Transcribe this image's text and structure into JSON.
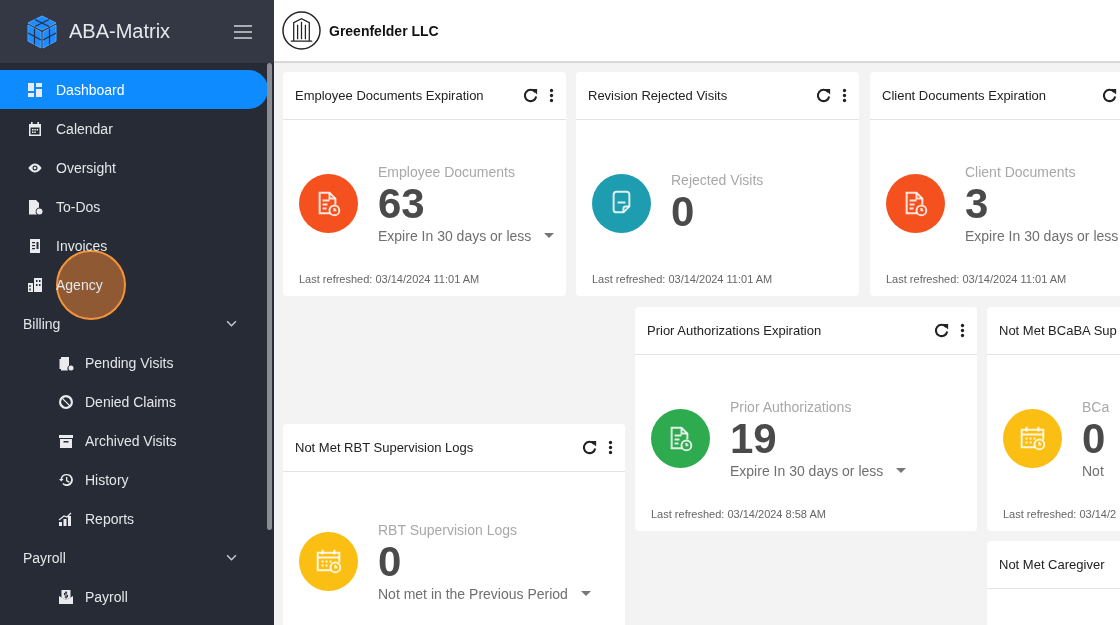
{
  "app": {
    "name": "ABA-Matrix"
  },
  "sidebar": {
    "items": [
      {
        "kind": "link",
        "label": "Dashboard",
        "selected": true
      },
      {
        "kind": "link",
        "label": "Calendar",
        "selected": false
      },
      {
        "kind": "link",
        "label": "Oversight",
        "selected": false
      },
      {
        "kind": "link",
        "label": "To-Dos",
        "selected": false
      },
      {
        "kind": "link",
        "label": "Invoices",
        "selected": false
      },
      {
        "kind": "link",
        "label": "Agency",
        "selected": false
      },
      {
        "kind": "section",
        "label": "Billing",
        "expanded": true,
        "children": [
          {
            "label": "Pending Visits",
            "selected": false
          },
          {
            "label": "Denied Claims",
            "selected": false
          },
          {
            "label": "Archived Visits",
            "selected": false
          },
          {
            "label": "History",
            "selected": false
          },
          {
            "label": "Reports",
            "selected": false
          }
        ]
      },
      {
        "kind": "section",
        "label": "Payroll",
        "expanded": true,
        "children": [
          {
            "label": "Payroll",
            "selected": false
          }
        ]
      }
    ]
  },
  "topbar": {
    "company": "Greenfelder LLC"
  },
  "widgets": [
    {
      "title": "Employee Documents Expiration",
      "refresh": true,
      "menu": true,
      "color": "#f4511e",
      "label": "Employee Documents",
      "value": "63",
      "caption": "Expire In 30 days or less",
      "dropdown": true,
      "refreshed": "Last refreshed: 03/14/2024 11:01 AM"
    },
    {
      "title": "Revision Rejected Visits",
      "refresh": true,
      "menu": true,
      "color": "#1e9db0",
      "label": "Rejected Visits",
      "value": "0",
      "refreshed": "Last refreshed: 03/14/2024 11:01 AM"
    },
    {
      "title": "Client Documents Expiration",
      "refresh": true,
      "color": "#f4511e",
      "label": "Client Documents",
      "value": "3",
      "caption": "Expire In 30 days or less",
      "dropdown": false,
      "refreshed": "Last refreshed: 03/14/2024 11:01 AM"
    },
    {
      "title": "Prior Authorizations Expiration",
      "refresh": true,
      "menu": true,
      "color": "#2eaa4f",
      "label": "Prior Authorizations",
      "value": "19",
      "caption": "Expire In 30 days or less",
      "dropdown": true,
      "refreshed": "Last refreshed: 03/14/2024 8:58 AM"
    },
    {
      "title": "Not Met RBT Supervision Logs",
      "refresh": true,
      "menu": true,
      "color": "#fbbf14",
      "label": "RBT Supervision Logs",
      "value": "0",
      "caption": "Not met in the Previous Period",
      "dropdown": true
    },
    {
      "title": "Not Met BCaBA Sup",
      "color": "#fbbf14",
      "label": "BCa",
      "value": "0",
      "caption": "Not",
      "dropdown": false,
      "refreshed": "Last refreshed: 03/14/2"
    },
    {
      "title": "Not Met Caregiver"
    }
  ]
}
